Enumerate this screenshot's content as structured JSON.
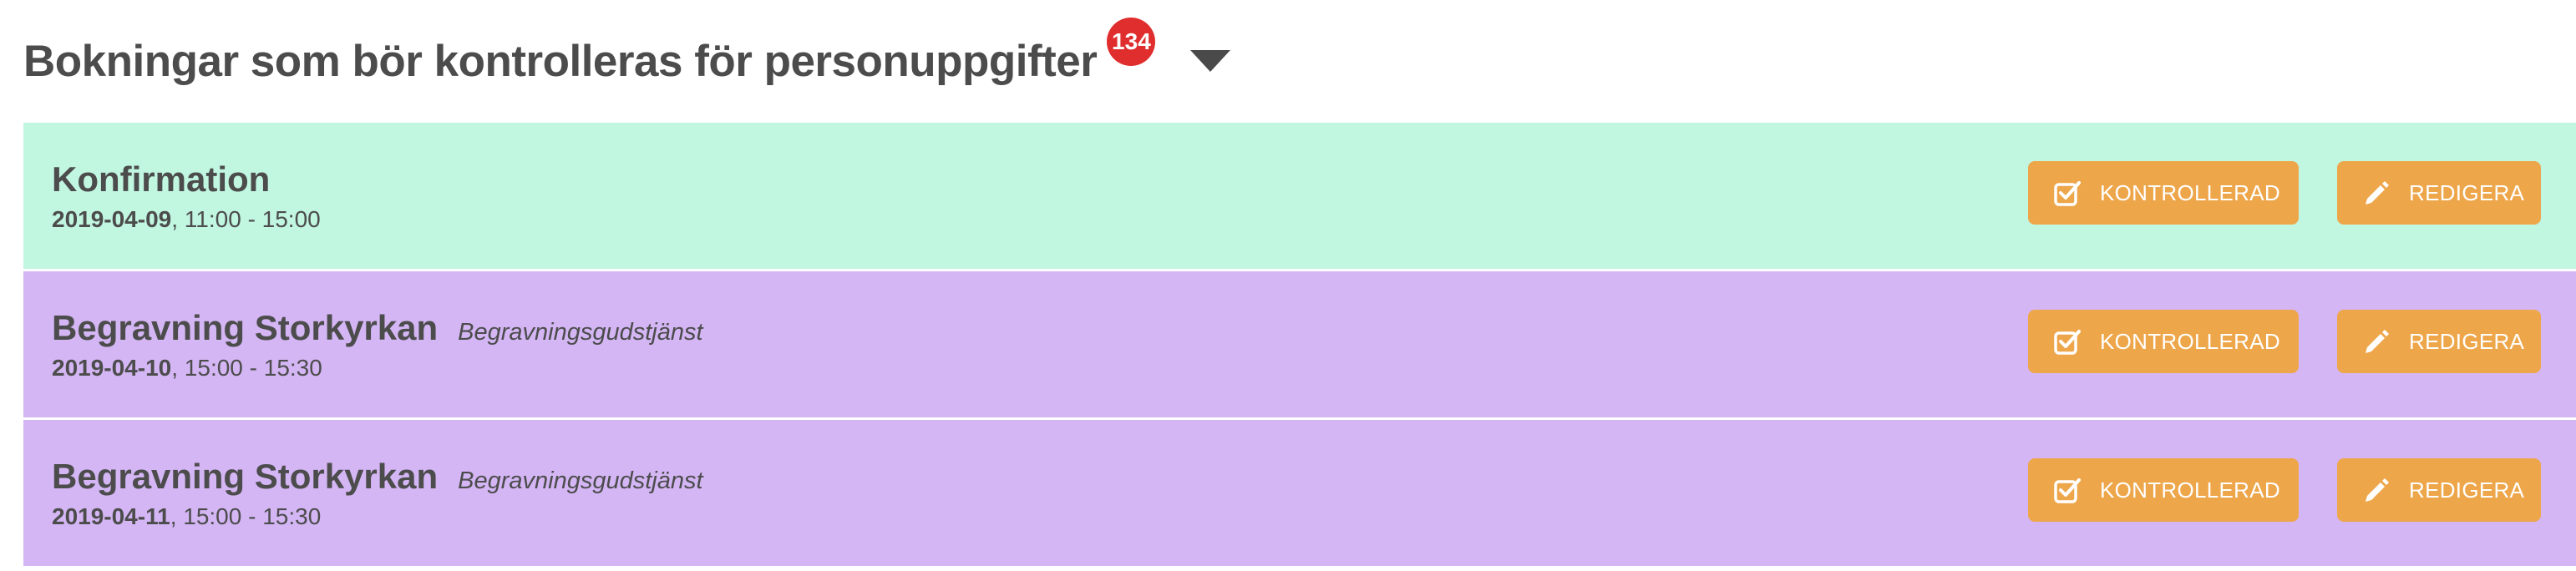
{
  "header": {
    "title": "Bokningar som bör kontrolleras för personuppgifter",
    "badge_count": "134",
    "toggle_icon": "caret-down-icon"
  },
  "colors": {
    "confirmation_bg": "#c1f6e1",
    "funeral_bg": "#d4b6f5",
    "button_bg": "#eea64a",
    "badge_bg": "#e02d2d"
  },
  "rows": [
    {
      "name": "Konfirmation",
      "type": "",
      "date": "2019-04-09",
      "time": ", 11:00 - 15:00",
      "bg": "#c1f6e1",
      "ok_label": "KONTROLLERAD",
      "edit_label": "REDIGERA"
    },
    {
      "name": "Begravning Storkyrkan",
      "type": "Begravningsgudstjänst",
      "date": "2019-04-10",
      "time": ", 15:00 - 15:30",
      "bg": "#d4b6f5",
      "ok_label": "KONTROLLERAD",
      "edit_label": "REDIGERA"
    },
    {
      "name": "Begravning Storkyrkan",
      "type": "Begravningsgudstjänst",
      "date": "2019-04-11",
      "time": ", 15:00 - 15:30",
      "bg": "#d4b6f5",
      "ok_label": "KONTROLLERAD",
      "edit_label": "REDIGERA"
    }
  ]
}
